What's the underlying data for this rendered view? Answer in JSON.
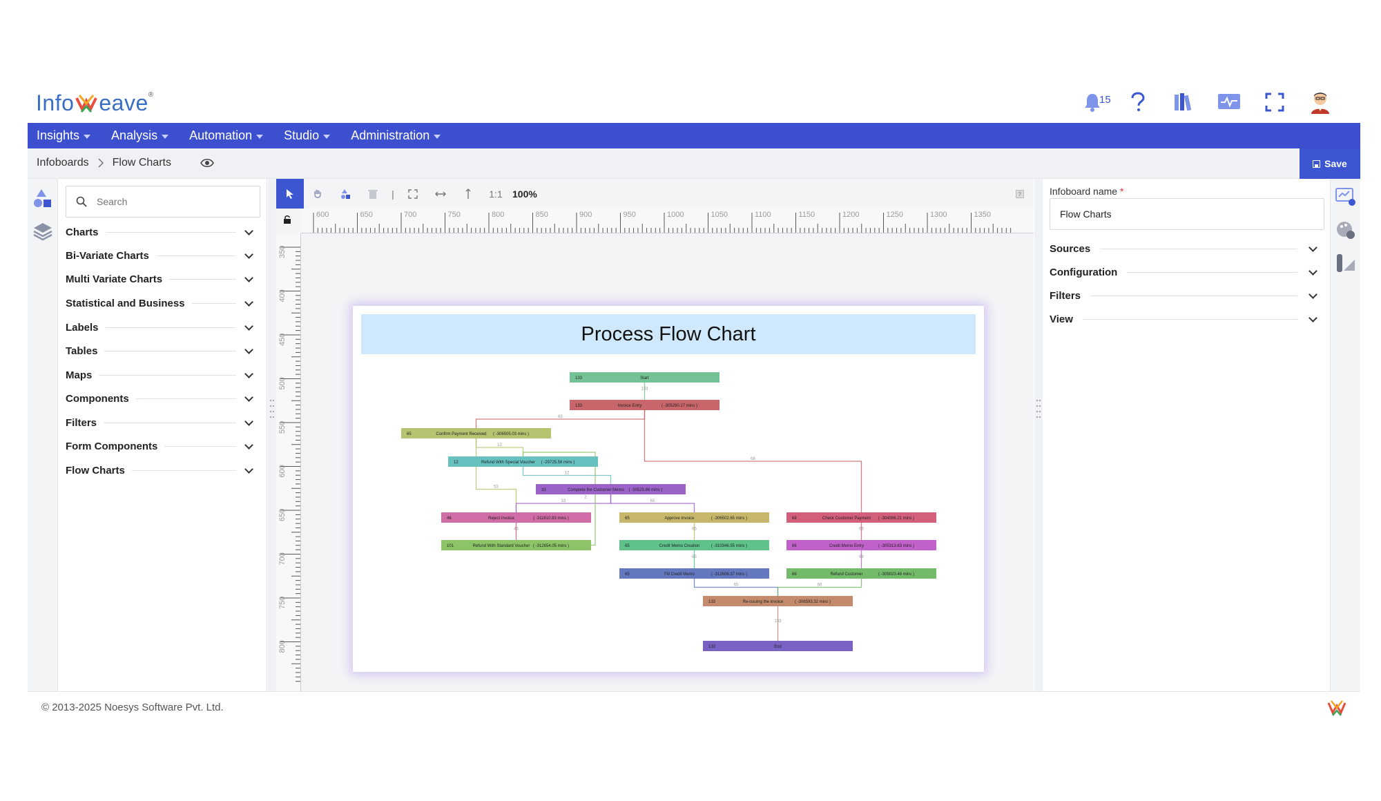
{
  "brand": {
    "logo_left": "Info",
    "logo_right": "eave"
  },
  "header": {
    "notifications_count": "15"
  },
  "nav": [
    {
      "label": "Insights"
    },
    {
      "label": "Analysis"
    },
    {
      "label": "Automation"
    },
    {
      "label": "Studio"
    },
    {
      "label": "Administration"
    }
  ],
  "breadcrumb": {
    "root": "Infoboards",
    "current": "Flow Charts"
  },
  "toolbar": {
    "save_label": "Save",
    "zoom": "100%",
    "ratio": "1:1"
  },
  "left_panel": {
    "search_placeholder": "Search",
    "categories": [
      "Charts",
      "Bi-Variate Charts",
      "Multi Variate Charts",
      "Statistical and Business",
      "Labels",
      "Tables",
      "Maps",
      "Components",
      "Filters",
      "Form Components",
      "Flow Charts"
    ]
  },
  "rulers": {
    "horizontal": [
      "600",
      "650",
      "700",
      "750",
      "800",
      "850",
      "900",
      "950",
      "1000",
      "1050",
      "1100",
      "1150",
      "1200",
      "1250",
      "1300",
      "1350"
    ],
    "vertical": [
      "350",
      "400",
      "450",
      "500",
      "550",
      "600",
      "650",
      "700",
      "750",
      "800"
    ]
  },
  "right_panel": {
    "infoboard_label": "Infoboard name",
    "infoboard_required": "*",
    "infoboard_value": "Flow Charts",
    "sections": [
      "Sources",
      "Configuration",
      "Filters",
      "View"
    ]
  },
  "chart_data": {
    "type": "diagram",
    "title": "Process Flow Chart",
    "nodes": [
      {
        "id": "start",
        "label": "Start",
        "count": "133",
        "duration": "",
        "color": "#74c295"
      },
      {
        "id": "invoice_entry",
        "label": "Invoice Entry",
        "count": "133",
        "duration": "( -305290.17 mins )",
        "color": "#c8666b"
      },
      {
        "id": "confirm_payment",
        "label": "Confirm Payment Received",
        "count": "65",
        "duration": "( -306505.03 mins )",
        "color": "#b5c471"
      },
      {
        "id": "refund_special",
        "label": "Refund With Special Voucher",
        "count": "12",
        "duration": "( -29725.58 mins )",
        "color": "#66c1bf"
      },
      {
        "id": "complete_memo",
        "label": "Complete the Customer Memo",
        "count": "33",
        "duration": "( -30525.86 mins )",
        "color": "#9b63c8"
      },
      {
        "id": "reject_invoice",
        "label": "Reject Invoice",
        "count": "46",
        "duration": "( -311610.83 mins )",
        "color": "#d06ca6"
      },
      {
        "id": "approve_invoice",
        "label": "Approve Invoice",
        "count": "65",
        "duration": "( -306502.65 mins )",
        "color": "#c6b76a"
      },
      {
        "id": "check_payment",
        "label": "Check Customer Payment",
        "count": "68",
        "duration": "( -304996.21 mins )",
        "color": "#d35f7b"
      },
      {
        "id": "refund_standard",
        "label": "Refund With Standard Voucher",
        "count": "101",
        "duration": "( -312654.05 mins )",
        "color": "#8cc467"
      },
      {
        "id": "credit_memo_creation",
        "label": "Credit Memo Creation",
        "count": "65",
        "duration": "( -310346.55 mins )",
        "color": "#5ec28a"
      },
      {
        "id": "credit_memo_entry",
        "label": "Credit Memo Entry",
        "count": "66",
        "duration": "( -305313.63 mins )",
        "color": "#c062c9"
      },
      {
        "id": "fill_credit_memo",
        "label": "Fill Credit Memo",
        "count": "65",
        "duration": "( -312606.37 mins )",
        "color": "#6478c0"
      },
      {
        "id": "refund_customer",
        "label": "Refund Customer",
        "count": "66",
        "duration": "( -309023.46 mins )",
        "color": "#73bb6a"
      },
      {
        "id": "reissuing_invoice",
        "label": "Re-issuing the invoice",
        "count": "133",
        "duration": "( -306593.32 mins )",
        "color": "#c48a6c"
      },
      {
        "id": "end",
        "label": "End",
        "count": "133",
        "duration": "",
        "color": "#7a62c4"
      }
    ],
    "edges": [
      {
        "from": "start",
        "to": "invoice_entry",
        "label": "133"
      },
      {
        "from": "invoice_entry",
        "to": "confirm_payment",
        "label": "65"
      },
      {
        "from": "invoice_entry",
        "to": "check_payment",
        "label": "68"
      },
      {
        "from": "confirm_payment",
        "to": "refund_special",
        "label": "12"
      },
      {
        "from": "confirm_payment",
        "to": "refund_standard",
        "label": "53"
      },
      {
        "from": "refund_special",
        "to": "complete_memo",
        "label": "12"
      },
      {
        "from": "complete_memo",
        "to": "reject_invoice",
        "label": "33"
      },
      {
        "from": "complete_memo",
        "to": "approve_invoice",
        "label": "65"
      },
      {
        "from": "reject_invoice",
        "to": "refund_standard",
        "label": "46"
      },
      {
        "from": "refund_standard",
        "to": "refund_special",
        "label": "2"
      },
      {
        "from": "approve_invoice",
        "to": "credit_memo_creation",
        "label": "65"
      },
      {
        "from": "credit_memo_creation",
        "to": "fill_credit_memo",
        "label": "65"
      },
      {
        "from": "check_payment",
        "to": "credit_memo_entry",
        "label": "66"
      },
      {
        "from": "credit_memo_entry",
        "to": "refund_customer",
        "label": "66"
      },
      {
        "from": "fill_credit_memo",
        "to": "reissuing_invoice",
        "label": "65"
      },
      {
        "from": "refund_customer",
        "to": "reissuing_invoice",
        "label": "66"
      },
      {
        "from": "reissuing_invoice",
        "to": "end",
        "label": "133"
      }
    ]
  },
  "footer": {
    "copyright": "© 2013-2025 Noesys Software Pvt. Ltd."
  }
}
